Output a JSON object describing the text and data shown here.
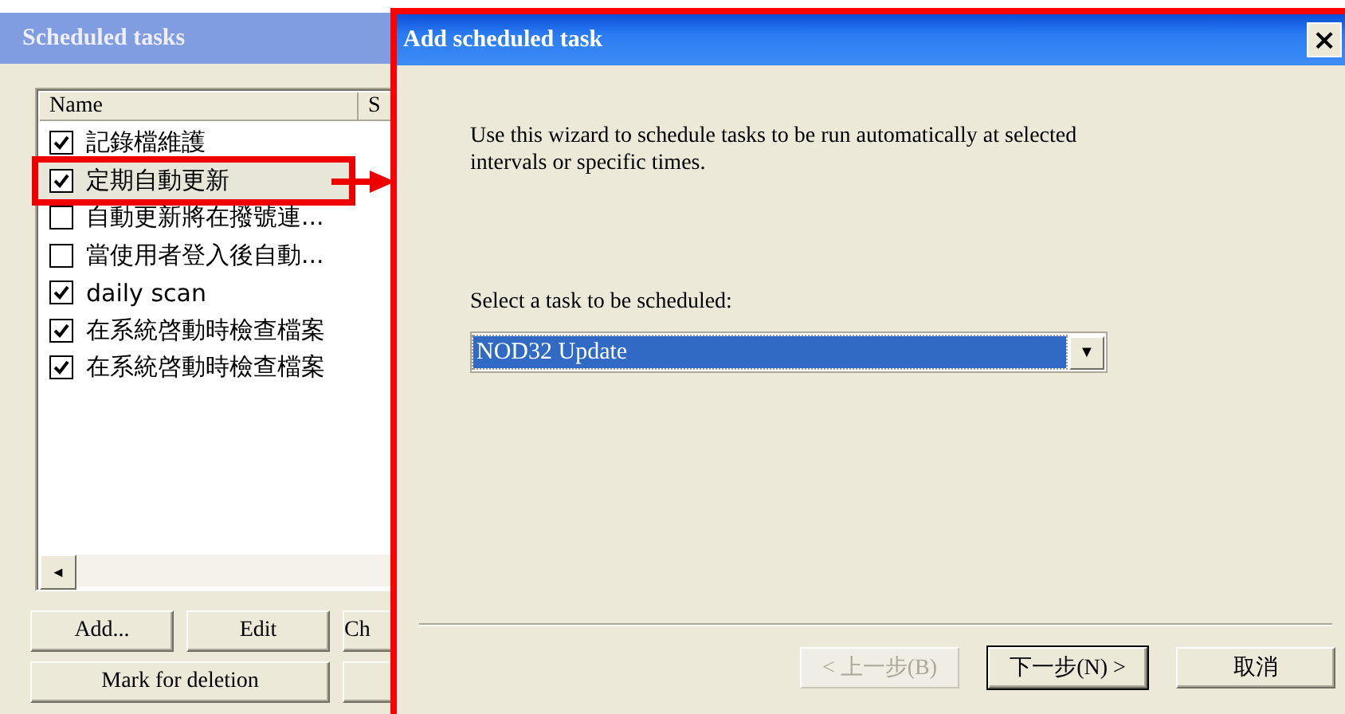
{
  "tasks_window": {
    "title": "Scheduled tasks",
    "columns": [
      "Name",
      "S"
    ],
    "tasks": [
      {
        "name": "記錄檔維護",
        "checked": true,
        "highlighted": false
      },
      {
        "name": "定期自動更新",
        "checked": true,
        "highlighted": true
      },
      {
        "name": "自動更新將在撥號連...",
        "checked": false,
        "highlighted": false
      },
      {
        "name": "當使用者登入後自動...",
        "checked": false,
        "highlighted": false
      },
      {
        "name": "daily scan",
        "checked": true,
        "highlighted": false
      },
      {
        "name": "在系統啓動時檢查檔案",
        "checked": true,
        "highlighted": false
      },
      {
        "name": "在系統啓動時檢查檔案",
        "checked": true,
        "highlighted": false
      }
    ],
    "scroll_left": "◄",
    "buttons": [
      [
        "Add...",
        "Edit",
        "Ch"
      ],
      [
        "Mark for deletion"
      ]
    ]
  },
  "dialog": {
    "title": "Add scheduled task",
    "close": "×",
    "intro": "Use this wizard to schedule tasks to be run automatically at selected intervals or specific times.",
    "select_label": "Select a task to be scheduled:",
    "task_select": {
      "value": "NOD32 Update",
      "arrow": "▼"
    },
    "buttons": [
      {
        "label": "< 上一步(B)",
        "disabled": true,
        "default": false
      },
      {
        "label": "下一步(N) >",
        "disabled": false,
        "default": true
      },
      {
        "label": "取消",
        "disabled": false,
        "default": false
      }
    ]
  }
}
